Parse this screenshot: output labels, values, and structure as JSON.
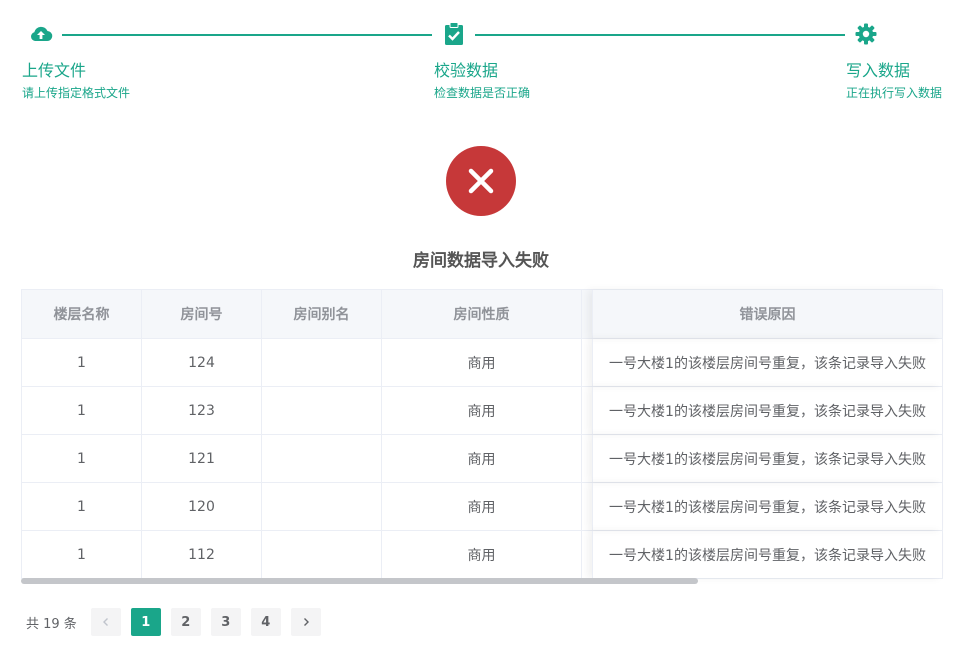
{
  "steps": [
    {
      "title": "上传文件",
      "desc": "请上传指定格式文件",
      "icon": "cloud-upload-icon"
    },
    {
      "title": "校验数据",
      "desc": "检查数据是否正确",
      "icon": "clipboard-check-icon"
    },
    {
      "title": "写入数据",
      "desc": "正在执行写入数据",
      "icon": "gear-icon"
    }
  ],
  "accent_color": "#1aa68a",
  "error_color": "#c63839",
  "result": {
    "title": "房间数据导入失败",
    "icon": "close-circle-icon"
  },
  "table": {
    "headers": [
      "楼层名称",
      "房间号",
      "房间别名",
      "房间性质",
      "",
      "错误原因"
    ],
    "rows": [
      [
        "1",
        "124",
        "",
        "商用",
        "",
        "一号大楼1的该楼层房间号重复，该条记录导入失败"
      ],
      [
        "1",
        "123",
        "",
        "商用",
        "",
        "一号大楼1的该楼层房间号重复，该条记录导入失败"
      ],
      [
        "1",
        "121",
        "",
        "商用",
        "",
        "一号大楼1的该楼层房间号重复，该条记录导入失败"
      ],
      [
        "1",
        "120",
        "",
        "商用",
        "",
        "一号大楼1的该楼层房间号重复，该条记录导入失败"
      ],
      [
        "1",
        "112",
        "",
        "商用",
        "",
        "一号大楼1的该楼层房间号重复，该条记录导入失败"
      ]
    ]
  },
  "pagination": {
    "total": "共 19 条",
    "pages": [
      "1",
      "2",
      "3",
      "4"
    ],
    "current": "1"
  }
}
